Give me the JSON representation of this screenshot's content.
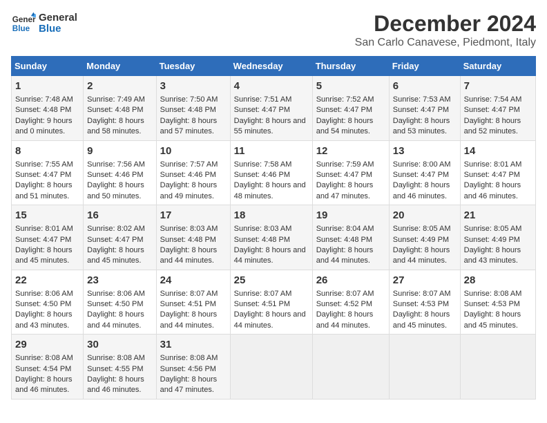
{
  "logo": {
    "line1": "General",
    "line2": "Blue"
  },
  "title": "December 2024",
  "subtitle": "San Carlo Canavese, Piedmont, Italy",
  "days_of_week": [
    "Sunday",
    "Monday",
    "Tuesday",
    "Wednesday",
    "Thursday",
    "Friday",
    "Saturday"
  ],
  "weeks": [
    [
      {
        "day": "1",
        "sunrise": "Sunrise: 7:48 AM",
        "sunset": "Sunset: 4:48 PM",
        "daylight": "Daylight: 9 hours and 0 minutes."
      },
      {
        "day": "2",
        "sunrise": "Sunrise: 7:49 AM",
        "sunset": "Sunset: 4:48 PM",
        "daylight": "Daylight: 8 hours and 58 minutes."
      },
      {
        "day": "3",
        "sunrise": "Sunrise: 7:50 AM",
        "sunset": "Sunset: 4:48 PM",
        "daylight": "Daylight: 8 hours and 57 minutes."
      },
      {
        "day": "4",
        "sunrise": "Sunrise: 7:51 AM",
        "sunset": "Sunset: 4:47 PM",
        "daylight": "Daylight: 8 hours and 55 minutes."
      },
      {
        "day": "5",
        "sunrise": "Sunrise: 7:52 AM",
        "sunset": "Sunset: 4:47 PM",
        "daylight": "Daylight: 8 hours and 54 minutes."
      },
      {
        "day": "6",
        "sunrise": "Sunrise: 7:53 AM",
        "sunset": "Sunset: 4:47 PM",
        "daylight": "Daylight: 8 hours and 53 minutes."
      },
      {
        "day": "7",
        "sunrise": "Sunrise: 7:54 AM",
        "sunset": "Sunset: 4:47 PM",
        "daylight": "Daylight: 8 hours and 52 minutes."
      }
    ],
    [
      {
        "day": "8",
        "sunrise": "Sunrise: 7:55 AM",
        "sunset": "Sunset: 4:47 PM",
        "daylight": "Daylight: 8 hours and 51 minutes."
      },
      {
        "day": "9",
        "sunrise": "Sunrise: 7:56 AM",
        "sunset": "Sunset: 4:46 PM",
        "daylight": "Daylight: 8 hours and 50 minutes."
      },
      {
        "day": "10",
        "sunrise": "Sunrise: 7:57 AM",
        "sunset": "Sunset: 4:46 PM",
        "daylight": "Daylight: 8 hours and 49 minutes."
      },
      {
        "day": "11",
        "sunrise": "Sunrise: 7:58 AM",
        "sunset": "Sunset: 4:46 PM",
        "daylight": "Daylight: 8 hours and 48 minutes."
      },
      {
        "day": "12",
        "sunrise": "Sunrise: 7:59 AM",
        "sunset": "Sunset: 4:47 PM",
        "daylight": "Daylight: 8 hours and 47 minutes."
      },
      {
        "day": "13",
        "sunrise": "Sunrise: 8:00 AM",
        "sunset": "Sunset: 4:47 PM",
        "daylight": "Daylight: 8 hours and 46 minutes."
      },
      {
        "day": "14",
        "sunrise": "Sunrise: 8:01 AM",
        "sunset": "Sunset: 4:47 PM",
        "daylight": "Daylight: 8 hours and 46 minutes."
      }
    ],
    [
      {
        "day": "15",
        "sunrise": "Sunrise: 8:01 AM",
        "sunset": "Sunset: 4:47 PM",
        "daylight": "Daylight: 8 hours and 45 minutes."
      },
      {
        "day": "16",
        "sunrise": "Sunrise: 8:02 AM",
        "sunset": "Sunset: 4:47 PM",
        "daylight": "Daylight: 8 hours and 45 minutes."
      },
      {
        "day": "17",
        "sunrise": "Sunrise: 8:03 AM",
        "sunset": "Sunset: 4:48 PM",
        "daylight": "Daylight: 8 hours and 44 minutes."
      },
      {
        "day": "18",
        "sunrise": "Sunrise: 8:03 AM",
        "sunset": "Sunset: 4:48 PM",
        "daylight": "Daylight: 8 hours and 44 minutes."
      },
      {
        "day": "19",
        "sunrise": "Sunrise: 8:04 AM",
        "sunset": "Sunset: 4:48 PM",
        "daylight": "Daylight: 8 hours and 44 minutes."
      },
      {
        "day": "20",
        "sunrise": "Sunrise: 8:05 AM",
        "sunset": "Sunset: 4:49 PM",
        "daylight": "Daylight: 8 hours and 44 minutes."
      },
      {
        "day": "21",
        "sunrise": "Sunrise: 8:05 AM",
        "sunset": "Sunset: 4:49 PM",
        "daylight": "Daylight: 8 hours and 43 minutes."
      }
    ],
    [
      {
        "day": "22",
        "sunrise": "Sunrise: 8:06 AM",
        "sunset": "Sunset: 4:50 PM",
        "daylight": "Daylight: 8 hours and 43 minutes."
      },
      {
        "day": "23",
        "sunrise": "Sunrise: 8:06 AM",
        "sunset": "Sunset: 4:50 PM",
        "daylight": "Daylight: 8 hours and 44 minutes."
      },
      {
        "day": "24",
        "sunrise": "Sunrise: 8:07 AM",
        "sunset": "Sunset: 4:51 PM",
        "daylight": "Daylight: 8 hours and 44 minutes."
      },
      {
        "day": "25",
        "sunrise": "Sunrise: 8:07 AM",
        "sunset": "Sunset: 4:51 PM",
        "daylight": "Daylight: 8 hours and 44 minutes."
      },
      {
        "day": "26",
        "sunrise": "Sunrise: 8:07 AM",
        "sunset": "Sunset: 4:52 PM",
        "daylight": "Daylight: 8 hours and 44 minutes."
      },
      {
        "day": "27",
        "sunrise": "Sunrise: 8:07 AM",
        "sunset": "Sunset: 4:53 PM",
        "daylight": "Daylight: 8 hours and 45 minutes."
      },
      {
        "day": "28",
        "sunrise": "Sunrise: 8:08 AM",
        "sunset": "Sunset: 4:53 PM",
        "daylight": "Daylight: 8 hours and 45 minutes."
      }
    ],
    [
      {
        "day": "29",
        "sunrise": "Sunrise: 8:08 AM",
        "sunset": "Sunset: 4:54 PM",
        "daylight": "Daylight: 8 hours and 46 minutes."
      },
      {
        "day": "30",
        "sunrise": "Sunrise: 8:08 AM",
        "sunset": "Sunset: 4:55 PM",
        "daylight": "Daylight: 8 hours and 46 minutes."
      },
      {
        "day": "31",
        "sunrise": "Sunrise: 8:08 AM",
        "sunset": "Sunset: 4:56 PM",
        "daylight": "Daylight: 8 hours and 47 minutes."
      },
      null,
      null,
      null,
      null
    ]
  ]
}
